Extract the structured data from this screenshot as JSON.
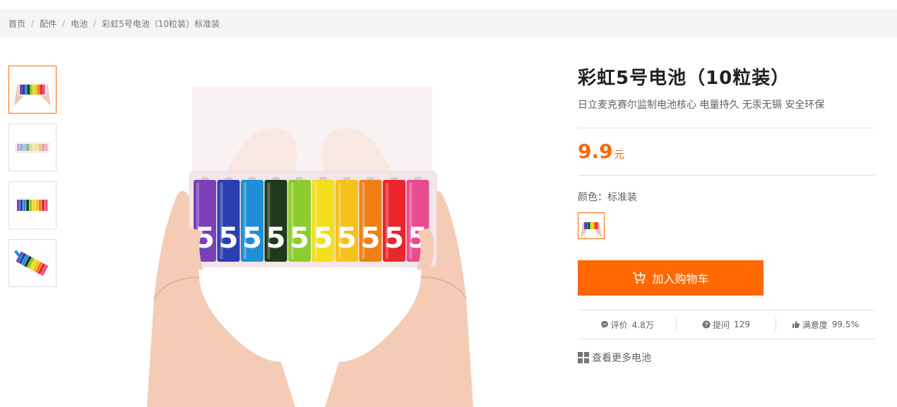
{
  "breadcrumb": {
    "items": [
      "首页",
      "配件",
      "电池",
      "彩虹5号电池（10粒装）标准装"
    ],
    "separator": "/"
  },
  "product": {
    "title": "彩虹5号电池（10粒装）",
    "description": "日立麦克赛尔监制电池核心 电量持久 无汞无镉 安全环保",
    "price": "9.9",
    "price_unit": "元",
    "color_label": "颜色：标准装",
    "add_to_cart_label": "加入购物车",
    "battery_number": "5"
  },
  "stats": {
    "reviews_label": "评价",
    "reviews_value": "4.8万",
    "questions_label": "提问",
    "questions_value": "129",
    "satisfaction_label": "满意度",
    "satisfaction_value": "99.5%"
  },
  "more_link": "查看更多电池",
  "colors": {
    "accent": "#ff6700",
    "batteries": [
      "#7b3fb8",
      "#2b3fae",
      "#1e8fd6",
      "#1f3a1c",
      "#8dcc2e",
      "#f3df1c",
      "#f6c21a",
      "#f08016",
      "#e8262c",
      "#e84c8f"
    ]
  }
}
